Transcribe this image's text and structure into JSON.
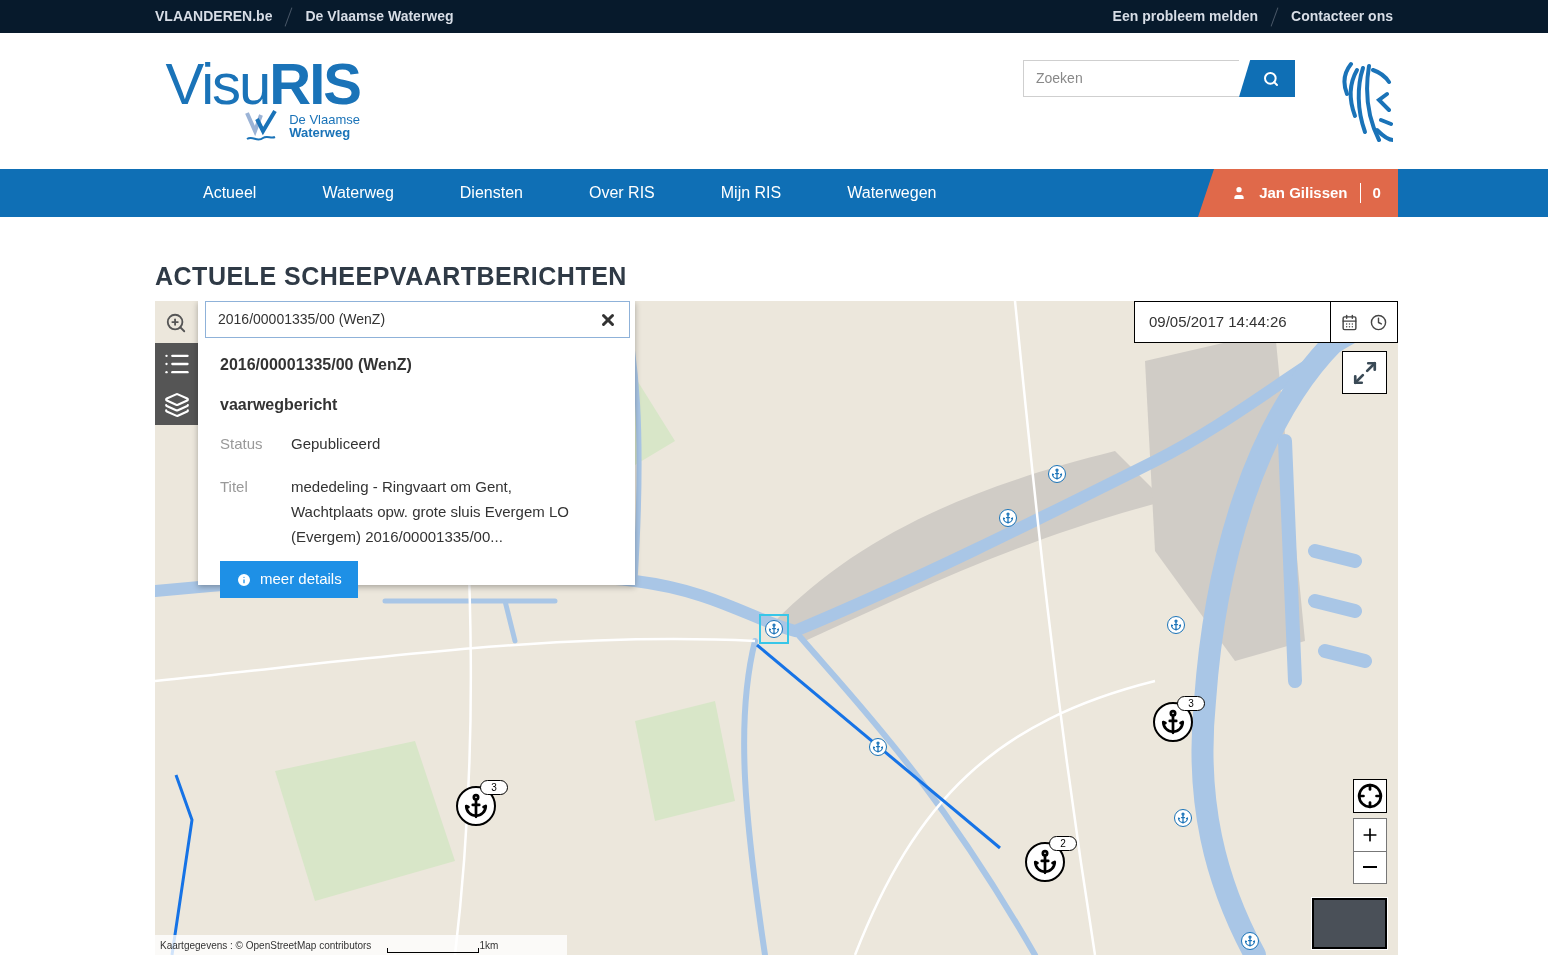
{
  "topbar": {
    "left_links": [
      "VLAANDEREN.be",
      "De Vlaamse Waterweg"
    ],
    "right_links": [
      "Een probleem melden",
      "Contacteer ons"
    ]
  },
  "logo": {
    "title": "Visu**RIS**",
    "subtitle_1": "De Vlaamse",
    "subtitle_2": "Waterweg"
  },
  "search": {
    "placeholder": "Zoeken"
  },
  "nav": {
    "items": [
      "Actueel",
      "Waterweg",
      "Diensten",
      "Over RIS",
      "Mijn RIS",
      "Waterwegen"
    ],
    "user": {
      "name": "Jan Gilissen",
      "count": "0"
    }
  },
  "page_title": "ACTUELE SCHEEPVAARTBERICHTEN",
  "map": {
    "search_value": "2016/00001335/00 (WenZ)",
    "popup": {
      "title": "2016/00001335/00 (WenZ)",
      "type": "vaarwegbericht",
      "fields": [
        {
          "label": "Status",
          "value": "Gepubliceerd"
        },
        {
          "label": "Titel",
          "value": "mededeling - Ringvaart om Gent, Wachtplaats opw. grote sluis Evergem LO (Evergem) 2016/00001335/00..."
        }
      ],
      "button": "meer details"
    },
    "datetime": "09/05/2017 14:44:26",
    "clusters": [
      {
        "count": "3"
      },
      {
        "count": "3"
      },
      {
        "count": "2"
      }
    ],
    "attribution": "Kaartgegevens : © OpenStreetMap contributors",
    "scale": "1km"
  }
}
